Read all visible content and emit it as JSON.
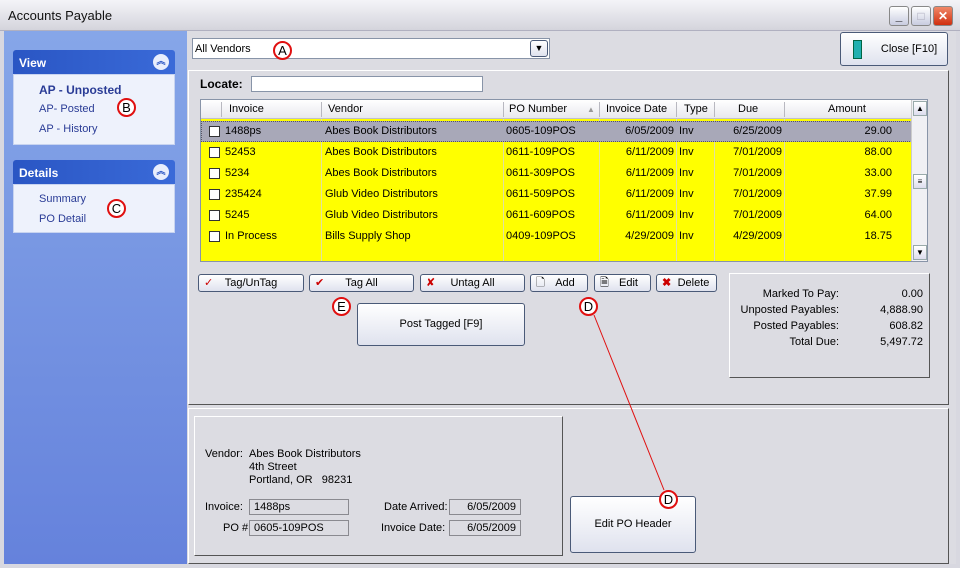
{
  "window": {
    "title": "Accounts Payable"
  },
  "sidebar": {
    "view": {
      "title": "View",
      "items": [
        {
          "label": "AP - Unposted",
          "active": true
        },
        {
          "label": "AP- Posted"
        },
        {
          "label": "AP - History"
        }
      ]
    },
    "details": {
      "title": "Details",
      "items": [
        {
          "label": "Summary"
        },
        {
          "label": "PO Detail"
        }
      ]
    }
  },
  "toolbar": {
    "vendor_filter": "All Vendors",
    "close_label": "Close [F10]"
  },
  "locate": {
    "label": "Locate:",
    "value": ""
  },
  "grid": {
    "columns": [
      "Invoice",
      "Vendor",
      "PO Number",
      "Invoice Date",
      "Type",
      "Due",
      "Amount"
    ],
    "sort_column": "PO Number",
    "rows": [
      {
        "invoice": "1488ps",
        "vendor": "Abes Book Distributors",
        "po": "0605-109POS",
        "invoice_date": "6/05/2009",
        "type": "Inv",
        "due": "6/25/2009",
        "amount": "29.00",
        "selected": true
      },
      {
        "invoice": "52453",
        "vendor": "Abes Book Distributors",
        "po": "0611-109POS",
        "invoice_date": "6/11/2009",
        "type": "Inv",
        "due": "7/01/2009",
        "amount": "88.00"
      },
      {
        "invoice": "5234",
        "vendor": "Abes Book Distributors",
        "po": "0611-309POS",
        "invoice_date": "6/11/2009",
        "type": "Inv",
        "due": "7/01/2009",
        "amount": "33.00"
      },
      {
        "invoice": "235424",
        "vendor": "Glub Video Distributors",
        "po": "0611-509POS",
        "invoice_date": "6/11/2009",
        "type": "Inv",
        "due": "7/01/2009",
        "amount": "37.99"
      },
      {
        "invoice": "5245",
        "vendor": "Glub Video Distributors",
        "po": "0611-609POS",
        "invoice_date": "6/11/2009",
        "type": "Inv",
        "due": "7/01/2009",
        "amount": "64.00"
      },
      {
        "invoice": "In Process",
        "vendor": "Bills Supply Shop",
        "po": "0409-109POS",
        "invoice_date": "4/29/2009",
        "type": "Inv",
        "due": "4/29/2009",
        "amount": "18.75"
      }
    ],
    "highlight_color": "#ffff00",
    "selected_color": "#a8a8b8"
  },
  "actions": {
    "tag_untag": "Tag/UnTag",
    "tag_all": "Tag All",
    "untag_all": "Untag All",
    "add": "Add",
    "edit": "Edit",
    "delete": "Delete",
    "post_tagged": "Post Tagged [F9]",
    "edit_po_header": "Edit PO Header"
  },
  "totals": [
    {
      "label": "Marked To Pay:",
      "value": "0.00"
    },
    {
      "label": "Unposted Payables:",
      "value": "4,888.90"
    },
    {
      "label": "Posted Payables:",
      "value": "608.82"
    },
    {
      "label": "Total Due:",
      "value": "5,497.72"
    }
  ],
  "detail": {
    "vendor_label": "Vendor:",
    "vendor_name": "Abes Book Distributors",
    "address1": "4th Street",
    "address2": "Portland, OR   98231",
    "invoice_label": "Invoice:",
    "invoice": "1488ps",
    "po_label": "PO #:",
    "po": "0605-109POS",
    "date_arrived_label": "Date Arrived:",
    "date_arrived": "6/05/2009",
    "invoice_date_label": "Invoice Date:",
    "invoice_date": "6/05/2009"
  },
  "annotations": {
    "a": "A",
    "b": "B",
    "c": "C",
    "d": "D",
    "e": "E"
  }
}
